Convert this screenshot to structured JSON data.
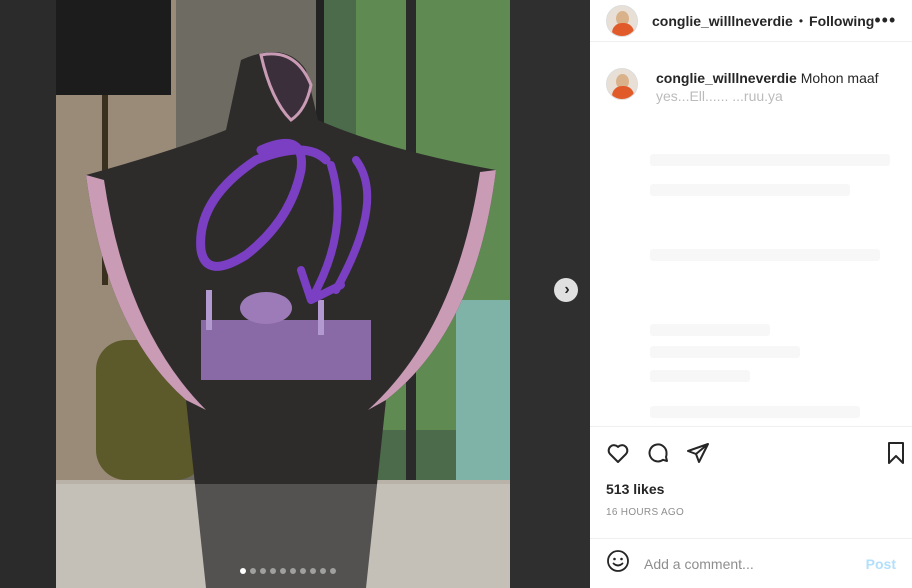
{
  "media": {
    "next_icon": "chevron-right-icon",
    "carousel_dots": 10,
    "active_dot": 0
  },
  "header": {
    "username": "conglie_willlneverdie",
    "separator": "•",
    "follow_label": "Following",
    "more_icon": "more-horizontal-icon",
    "more_label": "•••"
  },
  "caption": {
    "username": "conglie_willlneverdie",
    "text": "Mohon maaf",
    "faded_fragment": "yes...Ell...... ...ruu.ya"
  },
  "actions": {
    "like_icon": "heart-icon",
    "comment_icon": "comment-icon",
    "share_icon": "paper-plane-icon",
    "save_icon": "bookmark-icon"
  },
  "likes": "513 likes",
  "timestamp": "16 HOURS AGO",
  "comment_box": {
    "emoji_icon": "emoji-icon",
    "placeholder": "Add a comment...",
    "post_label": "Post"
  },
  "colors": {
    "text": "#262626",
    "muted": "#8e8e8e",
    "post_disabled": "#b2dffc",
    "accent_brand": "#e15a2a"
  }
}
